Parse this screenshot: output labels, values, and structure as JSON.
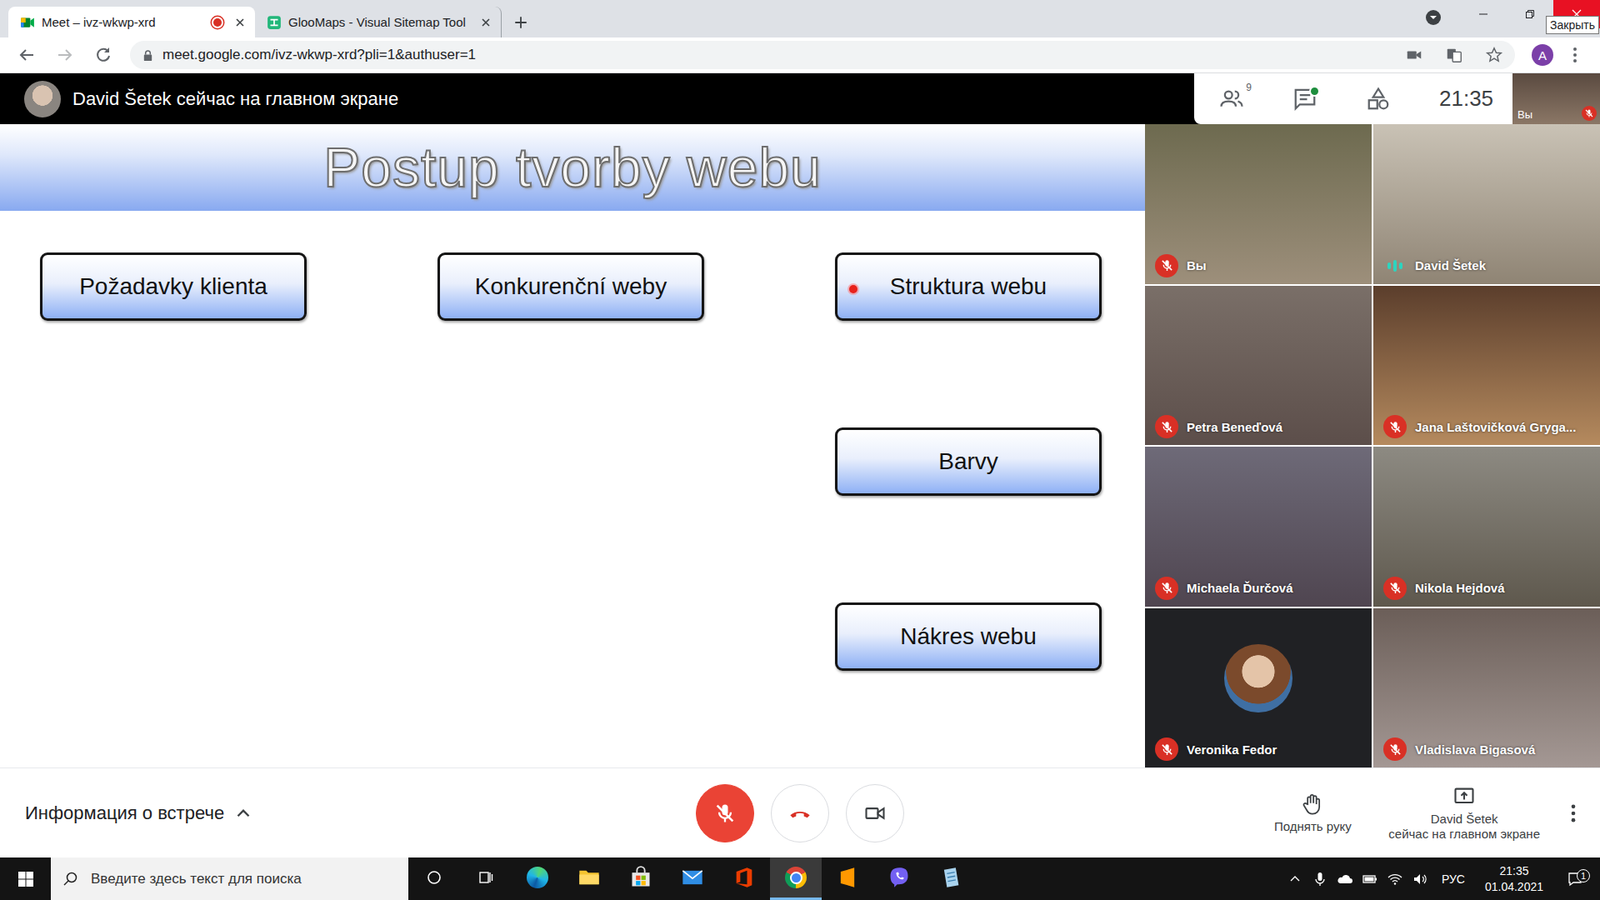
{
  "browser": {
    "tabs": [
      {
        "label": "Meet – ivz-wkwp-xrd",
        "kind": "meet",
        "selected": true,
        "recording": true
      },
      {
        "label": "GlooMaps - Visual Sitemap Tool",
        "kind": "gloomaps",
        "selected": false,
        "recording": false
      }
    ],
    "close_tooltip": "Закрыть",
    "url": "meet.google.com/ivz-wkwp-xrd?pli=1&authuser=1",
    "profile_initial": "A",
    "bookmarked": false
  },
  "meet": {
    "presenter_banner": "David Šetek сейчас на главном экране",
    "participants_count": "9",
    "chat_unread": true,
    "time": "21:35",
    "self_view": {
      "label": "Вы",
      "muted": true
    }
  },
  "slide": {
    "title": "Postup tvorby webu",
    "boxes": [
      {
        "label": "Požadavky klienta",
        "pointer": false
      },
      {
        "label": "Konkurenční weby",
        "pointer": false
      },
      {
        "label": "Struktura webu",
        "pointer": true
      },
      {
        "label": "Barvy",
        "pointer": false
      },
      {
        "label": "Nákres webu",
        "pointer": false
      }
    ]
  },
  "tiles": [
    {
      "name": "Вы",
      "kind": "video",
      "muted": true,
      "speaking": false
    },
    {
      "name": "David Šetek",
      "kind": "video",
      "muted": false,
      "speaking": true
    },
    {
      "name": "Petra Beneďová",
      "kind": "video",
      "muted": true,
      "speaking": false
    },
    {
      "name": "Jana Laštovičková Gryga...",
      "kind": "video",
      "muted": true,
      "speaking": false
    },
    {
      "name": "Michaela Ďurčová",
      "kind": "video",
      "muted": true,
      "speaking": false
    },
    {
      "name": "Nikola Hejdová",
      "kind": "video",
      "muted": true,
      "speaking": false
    },
    {
      "name": "Veronika Fedor",
      "kind": "avatar",
      "muted": true,
      "speaking": false
    },
    {
      "name": "Vladislava Bigasová",
      "kind": "video",
      "muted": true,
      "speaking": false
    }
  ],
  "controls": {
    "meeting_info": "Информация о встрече",
    "mic_muted": true,
    "camera_off": false,
    "raise_hand": "Поднять руку",
    "presenting_name": "David Šetek",
    "presenting_status": "сейчас на главном экране"
  },
  "taskbar": {
    "search_placeholder": "Введите здесь текст для поиска",
    "apps": [
      {
        "kind": "edge",
        "selected": false
      },
      {
        "kind": "explorer",
        "selected": false
      },
      {
        "kind": "store",
        "selected": false
      },
      {
        "kind": "mail",
        "selected": false
      },
      {
        "kind": "office",
        "selected": false
      },
      {
        "kind": "chrome",
        "selected": true
      },
      {
        "kind": "sublime",
        "selected": false
      },
      {
        "kind": "viber",
        "selected": false
      },
      {
        "kind": "notes",
        "selected": false
      }
    ],
    "language": "РУС",
    "time": "21:35",
    "date": "01.04.2021",
    "notifications": "1"
  }
}
